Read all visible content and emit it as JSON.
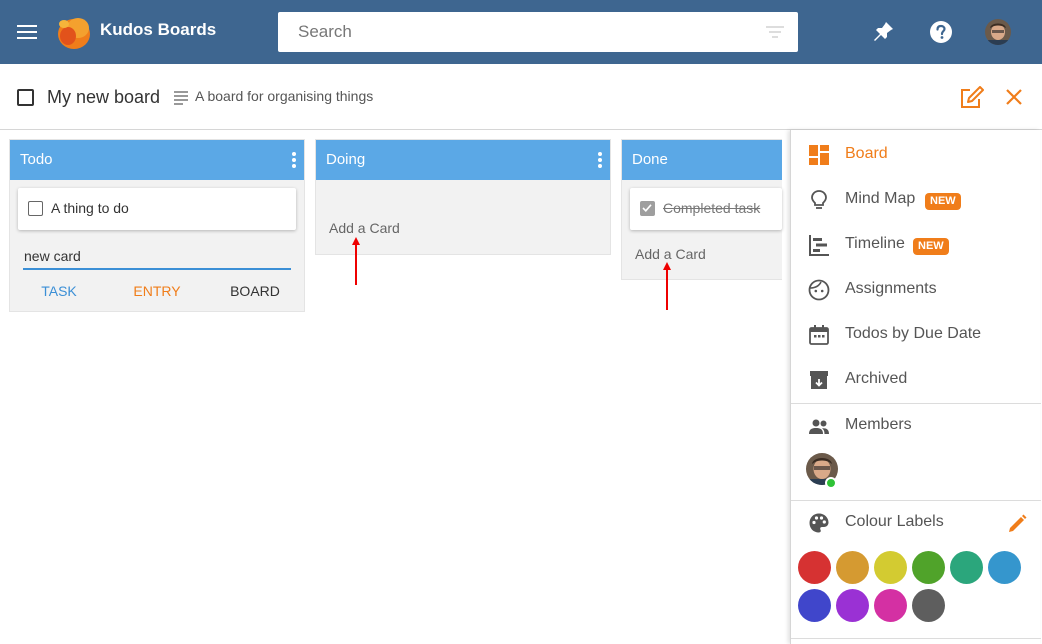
{
  "app": {
    "name": "Kudos Boards"
  },
  "search": {
    "placeholder": "Search"
  },
  "board": {
    "title": "My new board",
    "description": "A board for organising things"
  },
  "lists": [
    {
      "title": "Todo",
      "cards": [
        {
          "text": "A thing to do",
          "done": false
        }
      ],
      "new_card_value": "new card",
      "add_options": [
        "TASK",
        "ENTRY",
        "BOARD"
      ]
    },
    {
      "title": "Doing",
      "cards": [],
      "add_card_label": "Add a Card"
    },
    {
      "title": "Done",
      "cards": [
        {
          "text": "Completed task",
          "done": true
        }
      ],
      "add_card_label": "Add a Card"
    }
  ],
  "side_menu": {
    "items": [
      {
        "label": "Board",
        "icon": "dashboard-icon",
        "active": true
      },
      {
        "label": "Mind Map",
        "icon": "lightbulb-icon",
        "badge": "NEW"
      },
      {
        "label": "Timeline",
        "icon": "timeline-icon",
        "badge": "NEW"
      },
      {
        "label": "Assignments",
        "icon": "face-icon"
      },
      {
        "label": "Todos by Due Date",
        "icon": "calendar-icon"
      },
      {
        "label": "Archived",
        "icon": "archive-icon"
      }
    ],
    "members_label": "Members",
    "colour_labels_label": "Colour Labels"
  },
  "colors": {
    "topbar": "#3e6690",
    "list_header": "#5ba8e6",
    "accent": "#f07d1a",
    "online": "#2fc236",
    "annotation_arrow": "#ee0000",
    "labels": [
      "#d63232",
      "#d59a31",
      "#d3cb31",
      "#50a32a",
      "#2ba67c",
      "#3596cd",
      "#4046cb",
      "#9a31d4",
      "#d430a3",
      "#5e5e5e"
    ]
  }
}
